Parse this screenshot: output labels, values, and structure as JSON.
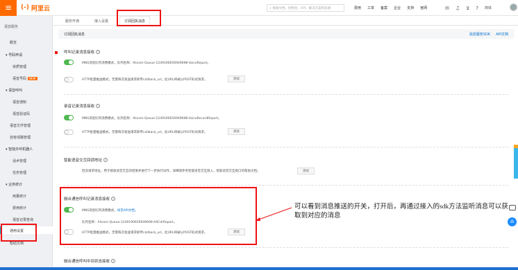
{
  "topbar": {
    "logo_text": "阿里云",
    "logo_mark": "(-)",
    "search_placeholder": "搜索文档、控制台、API、解决方案和资源",
    "nav": [
      "费用",
      "工单",
      "备案",
      "企业",
      "支持",
      "官网"
    ],
    "user_label": "简体"
  },
  "sidebar": {
    "title": "语音服务",
    "items": [
      {
        "label": "概览"
      },
      {
        "label": "号码申请",
        "group": true
      },
      {
        "label": "资质管理"
      },
      {
        "label": "语音号码",
        "badge": "NEW"
      },
      {
        "label": "语音呼叫",
        "group": true
      },
      {
        "label": "语音通知"
      },
      {
        "label": "语音验证码"
      },
      {
        "label": "语音文件管理"
      },
      {
        "label": "自有线路管理"
      },
      {
        "label": "智能外呼机器人",
        "group": true
      },
      {
        "label": "话术管理"
      },
      {
        "label": "任务管理"
      },
      {
        "label": "业务统计",
        "group": true
      },
      {
        "label": "用量统计"
      },
      {
        "label": "费用统计"
      },
      {
        "label": "语音记录查询"
      },
      {
        "label": "通用设置",
        "active": true
      },
      {
        "label": "帮助文档"
      }
    ]
  },
  "tabs": [
    "服务开通",
    "接入设置",
    "订阅回执消息"
  ],
  "subhead": {
    "title": "订阅回执消息",
    "links": [
      "消息服务SDK",
      "API文档"
    ]
  },
  "sections": [
    {
      "title": "呼叫记录消息接收",
      "rows": [
        {
          "toggle": "on",
          "text": "MNS消息队列消费模式，队列名称：Alicom-Queue-1249190656949698-VoiceReport。"
        },
        {
          "toggle": "off",
          "text": "HTTP批量推送模式，无需每次发送请求即传callback_url，此URL将被以POST形式请求。",
          "button": "测试"
        }
      ]
    },
    {
      "title": "录音记录消息接收",
      "rows": [
        {
          "toggle": "on",
          "text": "MNS消息队列消费模式，队列名称：Alicom-Queue-1249190656949698-VoiceRecordReport。"
        },
        {
          "toggle": "off",
          "text": "HTTP批量推送模式，无需每次发送请求即传callback_url，此URL将被以POST形式请求。",
          "button": "测试"
        }
      ]
    },
    {
      "title": "智能语音交互回调地址",
      "rows": [
        {
          "text": "回流请求地址，用于接收语音交互的结果并进行下一步执行动作，详细请参考智能语音交互接入，智能语音交互接口的帮助文档。",
          "button": "测试"
        }
      ]
    },
    {
      "title": "融合通信呼叫记录消息接收",
      "rows": [
        {
          "toggle": "on",
          "text": "MNS消息队列消费模式。",
          "link": "详见API文档。"
        },
        {
          "text": "队列名称：Alicom-Queue-1249190656949698-AXCdrReport。"
        },
        {
          "toggle": "off",
          "text": "HTTP批量推送模式，无需每次发送请求即传callback_url，此URL将被以POST形式请求。",
          "button": "测试"
        }
      ]
    },
    {
      "title": "融合通信呼叫中间状态接收"
    }
  ],
  "annotation": "可以看到消息推送的开关，打开后，再通过接入的sdk方法监听消息可以获取到对应的消息",
  "colors": {
    "brand": "#ff6a00",
    "toggle_on": "#4fb84f",
    "highlight": "#ee1111",
    "link": "#0070cc"
  },
  "icons": [
    "menu-icon",
    "search-icon",
    "mail-icon",
    "bell-icon",
    "cart-icon",
    "help-icon",
    "chat-icon",
    "fab-icon"
  ]
}
